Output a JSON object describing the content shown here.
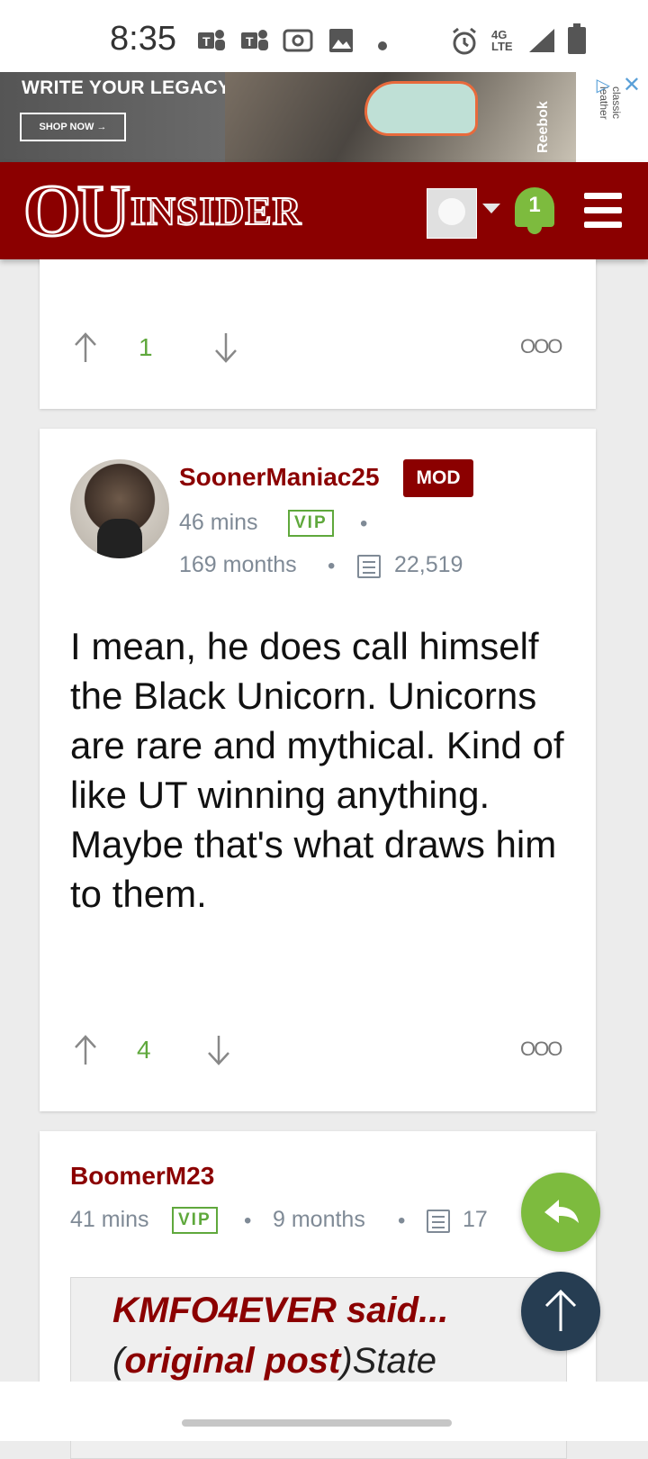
{
  "status_bar": {
    "time": "8:35",
    "network": "4G LTE",
    "icons": [
      "teams-icon",
      "teams-icon",
      "radio-icon",
      "image-icon",
      "dot-icon",
      "alarm-icon",
      "signal-icon",
      "battery-icon"
    ]
  },
  "ad": {
    "headline": "WRITE YOUR LEGACY",
    "cta": "SHOP NOW →",
    "brand": "Reebok",
    "side_text": "classic leather"
  },
  "header": {
    "logo_ou": "OU",
    "logo_insider": "INSIDER",
    "notification_count": "1",
    "colors": {
      "brand": "#8b0000",
      "accent": "#7dbb3e"
    }
  },
  "posts": [
    {
      "votes": "1"
    },
    {
      "username": "SoonerManiac25",
      "badge": "MOD",
      "time": "46 mins",
      "vip": "VIP",
      "tenure": "169 months",
      "message_count": "22,519",
      "body": "I mean, he does call himself the Black Unicorn. Unicorns are rare and mythical. Kind of like UT winning anything. Maybe that's what draws him to them.",
      "votes": "4"
    },
    {
      "username": "BoomerM23",
      "time": "41 mins",
      "vip": "VIP",
      "tenure": "9 months",
      "message_count": "17",
      "quote_author": "KMFO4EVER said...",
      "quote_prefix": "(",
      "quote_link": "original post",
      "quote_suffix": ")State"
    }
  ],
  "more_label": "OOO"
}
